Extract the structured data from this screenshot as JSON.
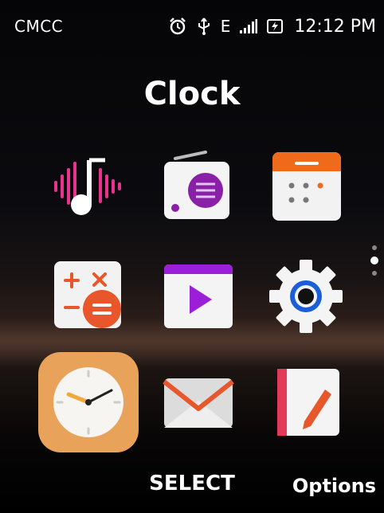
{
  "status": {
    "carrier": "CMCC",
    "network": "E",
    "time": "12:12 PM",
    "icons": [
      "alarm-icon",
      "usb-icon",
      "network-e-icon",
      "signal-icon",
      "battery-charging-icon"
    ]
  },
  "title": "Clock",
  "apps": [
    {
      "name": "music",
      "icon": "music-icon"
    },
    {
      "name": "fm-radio",
      "icon": "radio-icon"
    },
    {
      "name": "calendar",
      "icon": "calendar-icon"
    },
    {
      "name": "calculator",
      "icon": "calculator-icon"
    },
    {
      "name": "video",
      "icon": "video-play-icon"
    },
    {
      "name": "settings",
      "icon": "gear-icon"
    },
    {
      "name": "clock",
      "icon": "clock-icon",
      "selected": true
    },
    {
      "name": "email",
      "icon": "mail-icon"
    },
    {
      "name": "notes",
      "icon": "note-pencil-icon"
    }
  ],
  "pager": {
    "pages": 3,
    "current": 2
  },
  "softkeys": {
    "center": "SELECT",
    "right": "Options"
  }
}
